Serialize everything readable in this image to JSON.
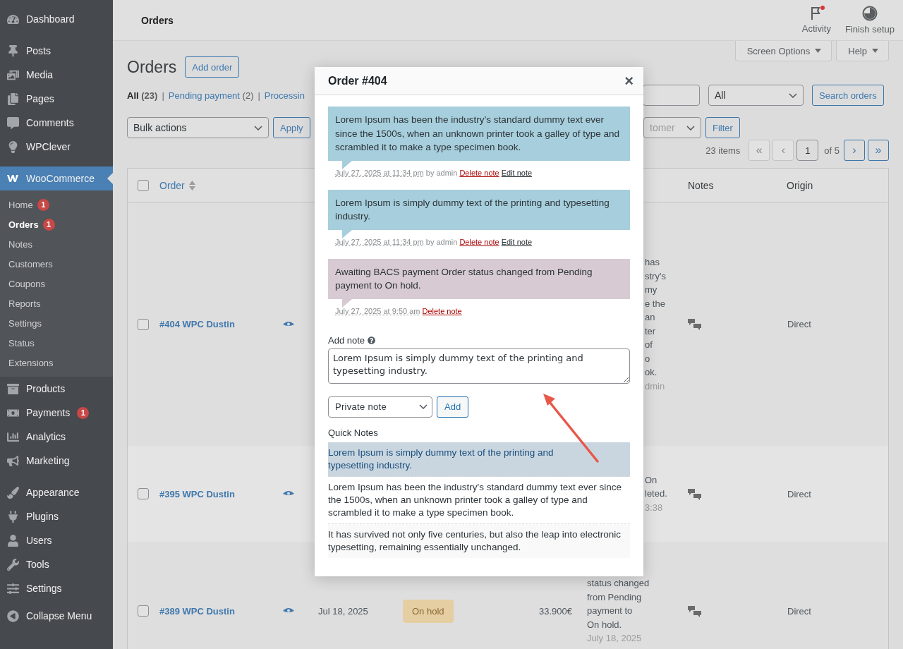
{
  "sidebar": {
    "groups": [
      {
        "items": [
          {
            "label": "Dashboard",
            "current": false
          }
        ]
      },
      {
        "items": [
          {
            "label": "Posts",
            "current": false
          },
          {
            "label": "Media",
            "current": false
          },
          {
            "label": "Pages",
            "current": false
          },
          {
            "label": "Comments",
            "current": false
          },
          {
            "label": "WPClever",
            "current": false
          }
        ]
      },
      {
        "items": [
          {
            "label": "WooCommerce",
            "current": true,
            "children": [
              {
                "label": "Home",
                "badge": "1",
                "selected": false
              },
              {
                "label": "Orders",
                "badge": "1",
                "selected": true
              },
              {
                "label": "Notes",
                "selected": false
              },
              {
                "label": "Customers",
                "selected": false
              },
              {
                "label": "Coupons",
                "selected": false
              },
              {
                "label": "Reports",
                "selected": false
              },
              {
                "label": "Settings",
                "selected": false
              },
              {
                "label": "Status",
                "selected": false
              },
              {
                "label": "Extensions",
                "selected": false
              }
            ]
          },
          {
            "label": "Products",
            "current": false
          },
          {
            "label": "Payments",
            "current": false,
            "badge": "1"
          },
          {
            "label": "Analytics",
            "current": false
          },
          {
            "label": "Marketing",
            "current": false
          }
        ]
      },
      {
        "items": [
          {
            "label": "Appearance",
            "current": false
          },
          {
            "label": "Plugins",
            "current": false
          },
          {
            "label": "Users",
            "current": false
          },
          {
            "label": "Tools",
            "current": false
          },
          {
            "label": "Settings",
            "current": false
          }
        ]
      }
    ],
    "collapse": "Collapse Menu"
  },
  "topbar": {
    "title": "Orders",
    "actions": [
      {
        "label": "Activity",
        "dot": true
      },
      {
        "label": "Finish setup",
        "dot": false
      }
    ]
  },
  "screen_meta": [
    {
      "label": "Screen Options"
    },
    {
      "label": "Help"
    }
  ],
  "page": {
    "title": "Orders",
    "add_button": "Add order"
  },
  "views": [
    {
      "label": "All",
      "count": "(23)",
      "selected": true
    },
    {
      "separator": "|",
      "label": "Pending payment",
      "count": "(2)",
      "selected": false
    },
    {
      "separator": "|",
      "label": "Processin",
      "selected": false
    }
  ],
  "status_filter": {
    "value": "All"
  },
  "search_button": "Search orders",
  "bulk": {
    "value": "Bulk actions"
  },
  "apply": "Apply",
  "customer_filter": {
    "placeholder": "tomer"
  },
  "filter_button": "Filter",
  "pagination": {
    "count": "23 items",
    "buttons_before": [
      {
        "label": "«",
        "disabled": true
      },
      {
        "label": "‹",
        "disabled": true
      }
    ],
    "page": "1",
    "total": "of 5",
    "buttons_after": [
      {
        "label": "›",
        "disabled": false
      },
      {
        "label": "»",
        "disabled": false
      }
    ]
  },
  "table": {
    "header_checkbox": {
      "checked": false
    },
    "columns": [
      {
        "label": "Order",
        "sortable": true
      },
      {
        "label": "Notes",
        "sortable": false
      },
      {
        "label": "Origin",
        "sortable": false
      }
    ],
    "rows": [
      {
        "checked": false,
        "order": "#404 WPC Dustin",
        "covered": true,
        "preview": {
          "lines": [
            "has",
            "stry's",
            "my",
            "e the",
            "an",
            "ter",
            "of",
            "o",
            "ok."
          ],
          "meta": "dmin"
        },
        "origin": "Direct"
      },
      {
        "checked": false,
        "order": "#395 WPC Dustin",
        "covered": true,
        "preview": {
          "lines": [
            "On",
            "leted."
          ],
          "meta": "3:38"
        },
        "origin": "Direct"
      },
      {
        "checked": false,
        "order": "#389 WPC Dustin",
        "covered": false,
        "date": "Jul 18, 2025",
        "status": "On hold",
        "total": "33.900€",
        "preview": {
          "lines": [
            "status changed",
            "from Pending",
            "payment to",
            "On hold."
          ],
          "meta": "July 18, 2025"
        },
        "origin": "Direct"
      }
    ]
  },
  "modal": {
    "title": "Order #404",
    "close": "×",
    "notes": [
      {
        "kind": "private",
        "text": "Lorem Ipsum has been the industry’s standard dummy text ever since the 1500s, when an unknown printer took a galley of type and scrambled it to make a type specimen book.",
        "date": "July 27, 2025 at 11:34 pm",
        "author": "by admin",
        "delete": "Delete note",
        "edit": "Edit note"
      },
      {
        "kind": "private",
        "text": "Lorem Ipsum is simply dummy text of the printing and typesetting industry.",
        "date": "July 27, 2025 at 11:34 pm",
        "author": "by admin",
        "delete": "Delete note",
        "edit": "Edit note"
      },
      {
        "kind": "system",
        "text": "Awaiting BACS payment Order status changed from Pending payment to On hold.",
        "date": "July 27, 2025 at 9:50 am",
        "delete": "Delete note"
      }
    ],
    "add_note": {
      "label": "Add note",
      "value": "Lorem Ipsum is simply dummy text of the printing and typesetting industry.",
      "type": "Private note",
      "button": "Add"
    },
    "quick_notes": {
      "title": "Quick Notes",
      "items": [
        {
          "text": "Lorem Ipsum is simply dummy text of the printing and typesetting industry.",
          "selected": true
        },
        {
          "text": "Lorem Ipsum has been the industry's standard dummy text ever since the 1500s, when an unknown printer took a galley of type and scrambled it to make a type specimen book.",
          "selected": false
        },
        {
          "text": "It has survived not only five centuries, but also the leap into electronic typesetting, remaining essentially unchanged.",
          "selected": false
        }
      ]
    }
  }
}
